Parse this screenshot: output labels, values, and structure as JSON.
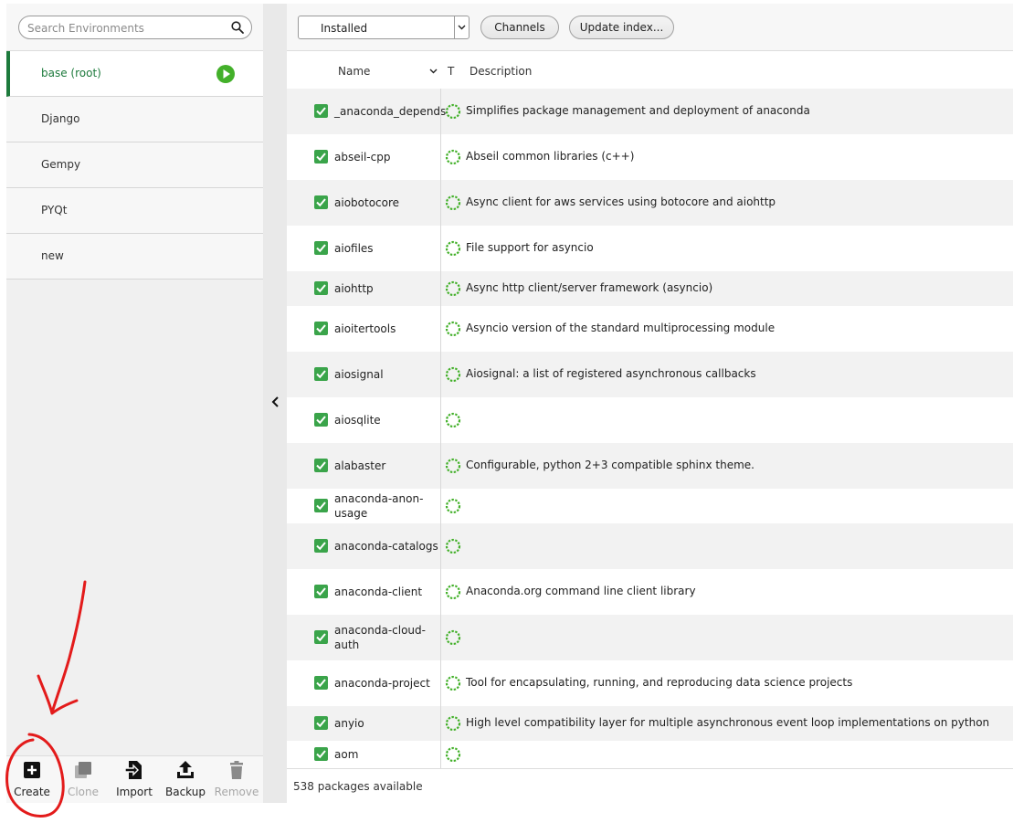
{
  "colors": {
    "accent": "#1d7a3c",
    "check": "#3aa44a",
    "play": "#43b02a",
    "annotation": "#e31b1b"
  },
  "search": {
    "placeholder": "Search Environments",
    "icon": "search-icon"
  },
  "environments": [
    {
      "label": "base (root)",
      "active": true
    },
    {
      "label": "Django",
      "active": false
    },
    {
      "label": "Gempy",
      "active": false
    },
    {
      "label": "PYQt",
      "active": false
    },
    {
      "label": "new",
      "active": false
    }
  ],
  "env_actions": {
    "create": "Create",
    "clone": "Clone",
    "import": "Import",
    "backup": "Backup",
    "remove": "Remove"
  },
  "toolbar": {
    "filter_value": "Installed",
    "channels": "Channels",
    "update_index": "Update index..."
  },
  "table": {
    "name_header": "Name",
    "type_header": "T",
    "desc_header": "Description",
    "rows": [
      {
        "name": "_anaconda_depends",
        "description": "Simplifies package management and deployment of anaconda"
      },
      {
        "name": "abseil-cpp",
        "description": "Abseil common libraries (c++)"
      },
      {
        "name": "aiobotocore",
        "description": "Async client for aws services using botocore and aiohttp"
      },
      {
        "name": "aiofiles",
        "description": "File support for asyncio"
      },
      {
        "name": "aiohttp",
        "description": "Async http client/server framework (asyncio)"
      },
      {
        "name": "aioitertools",
        "description": "Asyncio version of the standard multiprocessing module"
      },
      {
        "name": "aiosignal",
        "description": "Aiosignal: a list of registered asynchronous callbacks"
      },
      {
        "name": "aiosqlite",
        "description": ""
      },
      {
        "name": "alabaster",
        "description": "Configurable, python 2+3 compatible sphinx theme."
      },
      {
        "name": "anaconda-anon-usage",
        "description": ""
      },
      {
        "name": "anaconda-catalogs",
        "description": ""
      },
      {
        "name": "anaconda-client",
        "description": "Anaconda.org command line client library"
      },
      {
        "name": "anaconda-cloud-auth",
        "description": ""
      },
      {
        "name": "anaconda-project",
        "description": "Tool for encapsulating, running, and reproducing data science projects"
      },
      {
        "name": "anyio",
        "description": "High level compatibility layer for multiple asynchronous event loop implementations on python"
      },
      {
        "name": "aom",
        "description": ""
      }
    ]
  },
  "status": {
    "text": "538 packages available"
  }
}
